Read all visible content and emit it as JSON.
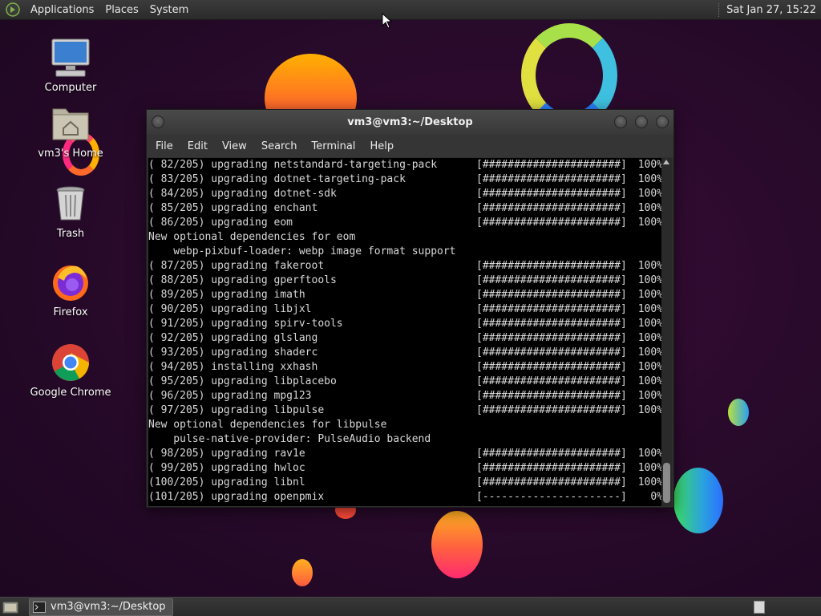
{
  "top_panel": {
    "menus": [
      "Applications",
      "Places",
      "System"
    ],
    "clock": "Sat Jan 27, 15:22"
  },
  "desktop_icons": [
    {
      "label": "Computer",
      "icon": "computer-icon"
    },
    {
      "label": "vm3's Home",
      "icon": "home-folder-icon"
    },
    {
      "label": "Trash",
      "icon": "trash-icon"
    },
    {
      "label": "Firefox",
      "icon": "firefox-icon"
    },
    {
      "label": "Google Chrome",
      "icon": "chrome-icon"
    }
  ],
  "terminal": {
    "title": "vm3@vm3:~/Desktop",
    "menu": [
      "File",
      "Edit",
      "View",
      "Search",
      "Terminal",
      "Help"
    ],
    "lines": [
      {
        "text": "( 82/205) upgrading netstandard-targeting-pack",
        "bar": "[######################]",
        "pct": "100%"
      },
      {
        "text": "( 83/205) upgrading dotnet-targeting-pack",
        "bar": "[######################]",
        "pct": "100%"
      },
      {
        "text": "( 84/205) upgrading dotnet-sdk",
        "bar": "[######################]",
        "pct": "100%"
      },
      {
        "text": "( 85/205) upgrading enchant",
        "bar": "[######################]",
        "pct": "100%"
      },
      {
        "text": "( 86/205) upgrading eom",
        "bar": "[######################]",
        "pct": "100%"
      },
      {
        "text": "New optional dependencies for eom",
        "bar": "",
        "pct": ""
      },
      {
        "text": "    webp-pixbuf-loader: webp image format support",
        "bar": "",
        "pct": ""
      },
      {
        "text": "( 87/205) upgrading fakeroot",
        "bar": "[######################]",
        "pct": "100%"
      },
      {
        "text": "( 88/205) upgrading gperftools",
        "bar": "[######################]",
        "pct": "100%"
      },
      {
        "text": "( 89/205) upgrading imath",
        "bar": "[######################]",
        "pct": "100%"
      },
      {
        "text": "( 90/205) upgrading libjxl",
        "bar": "[######################]",
        "pct": "100%"
      },
      {
        "text": "( 91/205) upgrading spirv-tools",
        "bar": "[######################]",
        "pct": "100%"
      },
      {
        "text": "( 92/205) upgrading glslang",
        "bar": "[######################]",
        "pct": "100%"
      },
      {
        "text": "( 93/205) upgrading shaderc",
        "bar": "[######################]",
        "pct": "100%"
      },
      {
        "text": "( 94/205) installing xxhash",
        "bar": "[######################]",
        "pct": "100%"
      },
      {
        "text": "( 95/205) upgrading libplacebo",
        "bar": "[######################]",
        "pct": "100%"
      },
      {
        "text": "( 96/205) upgrading mpg123",
        "bar": "[######################]",
        "pct": "100%"
      },
      {
        "text": "( 97/205) upgrading libpulse",
        "bar": "[######################]",
        "pct": "100%"
      },
      {
        "text": "New optional dependencies for libpulse",
        "bar": "",
        "pct": ""
      },
      {
        "text": "    pulse-native-provider: PulseAudio backend",
        "bar": "",
        "pct": ""
      },
      {
        "text": "( 98/205) upgrading rav1e",
        "bar": "[######################]",
        "pct": "100%"
      },
      {
        "text": "( 99/205) upgrading hwloc",
        "bar": "[######################]",
        "pct": "100%"
      },
      {
        "text": "(100/205) upgrading libnl",
        "bar": "[######################]",
        "pct": "100%"
      },
      {
        "text": "(101/205) upgrading openpmix",
        "bar": "[----------------------]",
        "pct": "0%"
      }
    ]
  },
  "taskbar": {
    "window_button": "vm3@vm3:~/Desktop"
  }
}
